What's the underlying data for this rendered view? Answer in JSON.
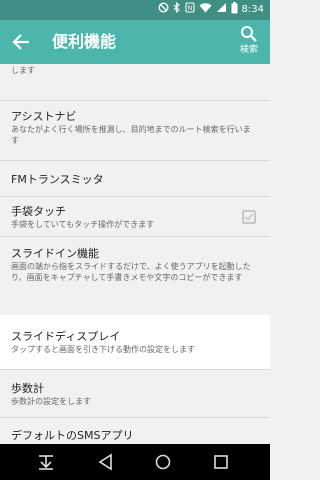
{
  "status_bar": {
    "time": "8:34"
  },
  "app_bar": {
    "title": "便利機能",
    "search_label": "検索"
  },
  "items": [
    {
      "summary_tail": "あなたが普段使っているアプリを、使いたいタイミングでアシストします"
    },
    {
      "title": "アシストナビ",
      "summary": "あなたがよく行く場所を推測し、目的地までのルート検索を行います"
    },
    {
      "title": "FMトランスミッタ"
    },
    {
      "title": "手袋タッチ",
      "summary": "手袋をしていてもタッチ操作ができます",
      "checked": true
    },
    {
      "title": "スライドイン機能",
      "summary": "画面の端から指をスライドするだけで、よく使うアプリを起動したり、画面をキャプチャして手書きメモや文字のコピーができます"
    },
    {
      "title": "スライドディスプレイ",
      "summary": "タップすると画面を引き下げる動作の設定をします"
    },
    {
      "title": "歩数計",
      "summary": "歩数計の設定をします"
    },
    {
      "title": "デフォルトのSMSアプリ"
    }
  ],
  "colors": {
    "status_bar": "#3f8f84",
    "app_bar": "#4db6ac",
    "background": "#f1f1f1",
    "highlight": "#ffffff"
  },
  "icons": {
    "back": "arrow-left-icon",
    "search": "search-icon",
    "nav": [
      "notification-pulldown-icon",
      "back-triangle-icon",
      "home-circle-icon",
      "recents-square-icon"
    ]
  }
}
